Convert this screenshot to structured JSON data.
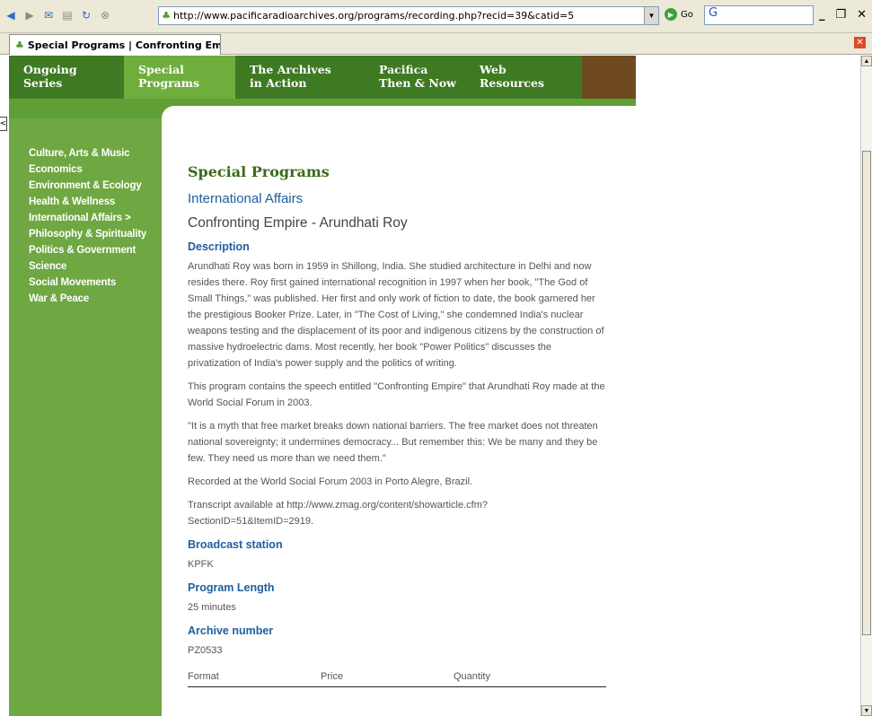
{
  "browser": {
    "url": "http://www.pacificaradioarchives.org/programs/recording.php?recid=39&catid=5",
    "go_label": "Go",
    "search_label": "G",
    "tab_title": "Special Programs | Confronting Empi..."
  },
  "nav": {
    "items": [
      {
        "line1": "Ongoing",
        "line2": "Series"
      },
      {
        "line1": "Special",
        "line2": "Programs"
      },
      {
        "line1": "The Archives",
        "line2": "in Action"
      },
      {
        "line1": "Pacifica",
        "line2": "Then & Now"
      },
      {
        "line1": "Web",
        "line2": "Resources"
      }
    ]
  },
  "sidebar": {
    "items": [
      "Culture, Arts & Music",
      "Economics",
      "Environment & Ecology",
      "Health & Wellness",
      "International Affairs >",
      "Philosophy & Spirituality",
      "Politics & Government",
      "Science",
      "Social Movements",
      "War & Peace"
    ]
  },
  "main": {
    "section_heading": "Special Programs",
    "category": "International Affairs",
    "title": "Confronting Empire - Arundhati Roy",
    "description_heading": "Description",
    "paragraphs": [
      "Arundhati Roy was born in 1959 in Shillong, India. She studied architecture in Delhi and now resides there. Roy first gained international recognition in 1997 when her book, \"The God of Small Things,\" was published. Her first and only work of fiction to date, the book garnered her the prestigious Booker Prize. Later, in \"The Cost of Living,\" she condemned India's nuclear weapons testing and the displacement of its poor and indigenous citizens by the construction of massive hydroelectric dams. Most recently, her book \"Power Politics\" discusses the privatization of India's power supply and the politics of writing.",
      "This program contains the speech entitled \"Confronting Empire\" that Arundhati Roy made at the World Social Forum in 2003.",
      "\"It is a myth that free market breaks down national barriers. The free market does not threaten national sovereignty; it undermines democracy... But remember this: We be many and they be few. They need us more than we need them.\"",
      "Recorded at the World Social Forum 2003 in Porto Alegre, Brazil.",
      "Transcript available at http://www.zmag.org/content/showarticle.cfm?SectionID=51&ItemID=2919."
    ],
    "broadcast_heading": "Broadcast station",
    "broadcast_value": "KPFK",
    "length_heading": "Program Length",
    "length_value": "25 minutes",
    "archive_heading": "Archive number",
    "archive_value": "PZ0533",
    "table_headers": [
      "Format",
      "Price",
      "Quantity"
    ]
  }
}
